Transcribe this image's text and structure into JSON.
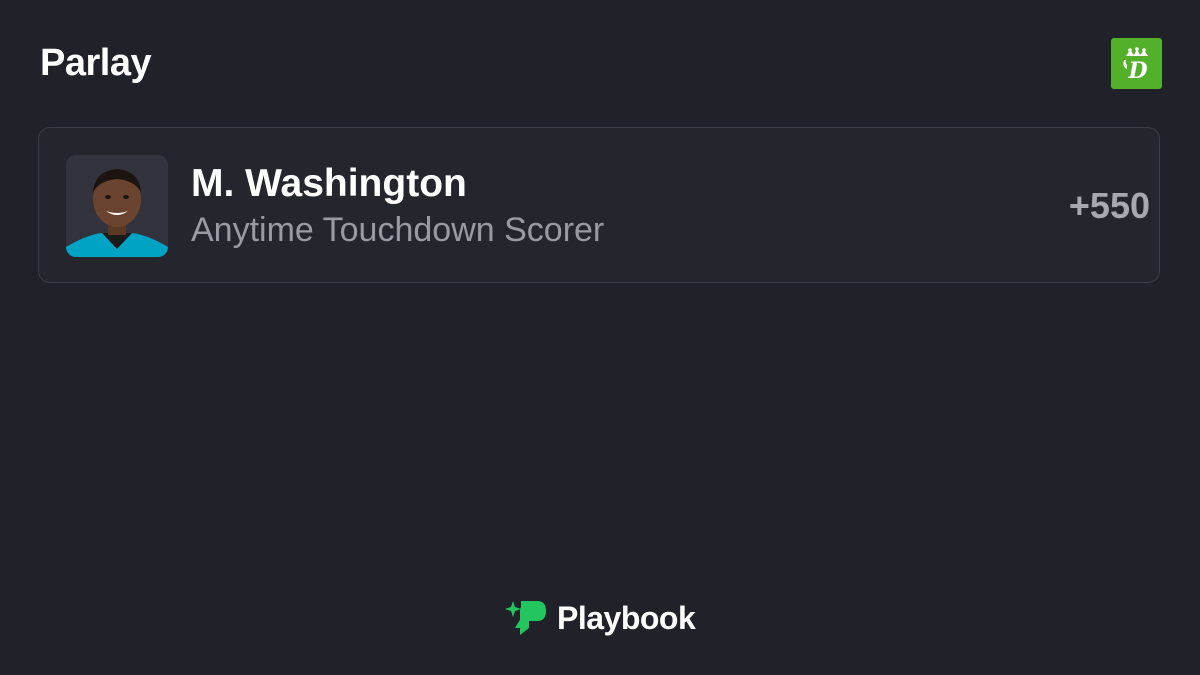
{
  "header": {
    "title": "Parlay",
    "sportsbook_logo": {
      "icon": "draftkings-logo-icon",
      "color": "#53b02a",
      "glyph": "D"
    }
  },
  "legs": [
    {
      "player_name": "M. Washington",
      "market": "Anytime Touchdown Scorer",
      "odds": "+550",
      "avatar": {
        "icon": "player-headshot",
        "jersey_color": "#00a3c4"
      }
    }
  ],
  "footer": {
    "brand_name": "Playbook",
    "brand_icon": "playbook-logo-icon",
    "brand_color": "#22c55e"
  },
  "colors": {
    "background": "#212129",
    "card_background": "#25252d",
    "card_border": "#3d3d47",
    "muted_text": "#9a9aa3",
    "odds_text": "#a8a8b0"
  }
}
